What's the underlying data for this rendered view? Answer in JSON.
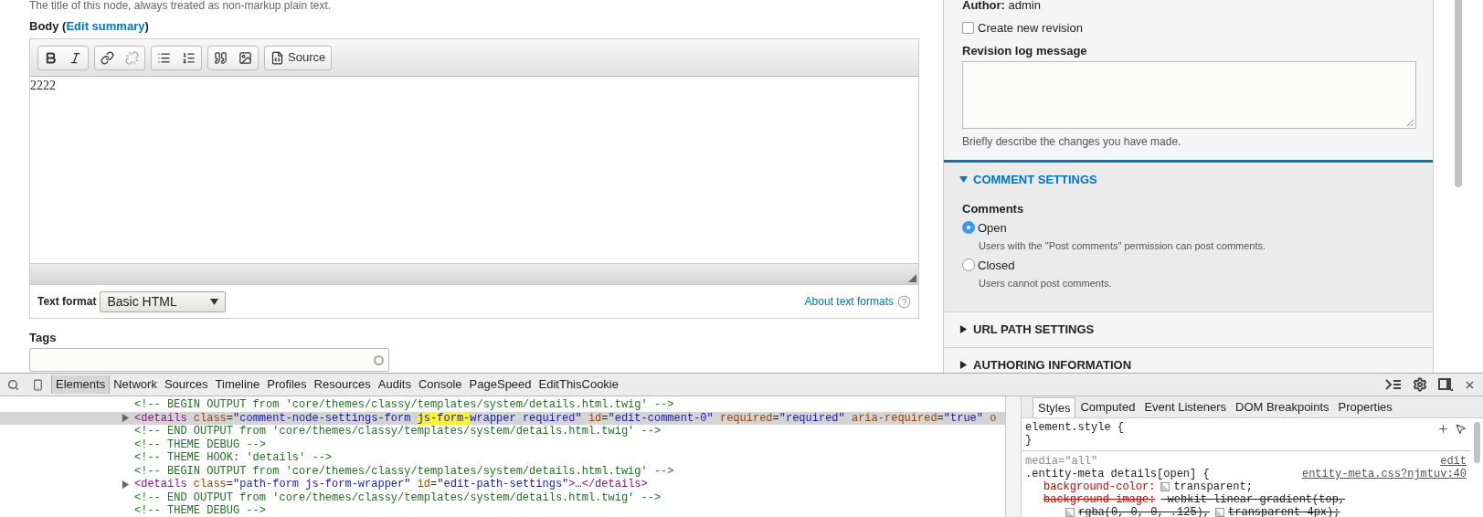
{
  "page": {
    "intro": "The title of this node, always treated as non-markup plain text.",
    "body": {
      "label_before": "Body (",
      "link": "Edit summary",
      "label_after": ")",
      "toolbar": [
        [
          {
            "kind": "bold",
            "disabled": false
          },
          {
            "kind": "italic",
            "disabled": false
          }
        ],
        [
          {
            "kind": "link",
            "disabled": false
          },
          {
            "kind": "unlink",
            "disabled": true
          }
        ],
        [
          {
            "kind": "bulleted-list",
            "disabled": false
          },
          {
            "kind": "numbered-list",
            "disabled": false
          }
        ],
        [
          {
            "kind": "blockquote",
            "disabled": false
          },
          {
            "kind": "image",
            "disabled": false
          }
        ],
        [
          {
            "kind": "source",
            "label": "Source",
            "disabled": false
          }
        ]
      ],
      "value": "2222",
      "text_format": {
        "label": "Text format",
        "value": "Basic HTML"
      },
      "about_link": "About text formats"
    },
    "tags": {
      "label": "Tags"
    }
  },
  "sidebar": {
    "author": "**Author:** admin",
    "revision_checkbox": {
      "label": "Create new revision",
      "checked": false
    },
    "revision_log": {
      "label": "Revision log message",
      "hint": "Briefly describe the changes you have made."
    },
    "sections": [
      {
        "title": "COMMENT SETTINGS",
        "expanded": true,
        "field": {
          "label": "Comments",
          "options": [
            {
              "label": "Open",
              "description": "Users with the \"Post comments\" permission can post comments.",
              "selected": true
            },
            {
              "label": "Closed",
              "description": "Users cannot post comments.",
              "selected": false
            }
          ]
        }
      },
      {
        "title": "URL PATH SETTINGS",
        "expanded": false
      },
      {
        "title": "AUTHORING INFORMATION",
        "expanded": false
      }
    ]
  },
  "devtools": {
    "tabs": [
      {
        "label": "Elements",
        "selected": true
      },
      {
        "label": "Network",
        "selected": false
      },
      {
        "label": "Sources",
        "selected": false
      },
      {
        "label": "Timeline",
        "selected": false
      },
      {
        "label": "Profiles",
        "selected": false
      },
      {
        "label": "Resources",
        "selected": false
      },
      {
        "label": "Audits",
        "selected": false
      },
      {
        "label": "Console",
        "selected": false
      },
      {
        "label": "PageSpeed",
        "selected": false
      },
      {
        "label": "EditThisCookie",
        "selected": false
      }
    ],
    "code_lines": [
      {
        "selected": false,
        "expandable": false,
        "segments": [
          {
            "kind": "comment",
            "text": "<!-- BEGIN OUTPUT from 'core/themes/classy/templates/system/details.html.twig' -->"
          }
        ]
      },
      {
        "selected": true,
        "expandable": true,
        "segments": [
          {
            "kind": "tag",
            "text": "<details"
          },
          {
            "kind": "attr",
            "text": " class"
          },
          {
            "kind": "plain",
            "text": "="
          },
          {
            "kind": "value",
            "text": "\"comment-node-settings-form "
          },
          {
            "kind": "match",
            "text": "js-form-"
          },
          {
            "kind": "value",
            "text": "wrapper required\""
          },
          {
            "kind": "attr",
            "text": " id"
          },
          {
            "kind": "plain",
            "text": "="
          },
          {
            "kind": "value",
            "text": "\"edit-comment-0\""
          },
          {
            "kind": "attr",
            "text": " required"
          },
          {
            "kind": "plain",
            "text": "="
          },
          {
            "kind": "value",
            "text": "\"required\""
          },
          {
            "kind": "attr",
            "text": " aria-required"
          },
          {
            "kind": "plain",
            "text": "="
          },
          {
            "kind": "value",
            "text": "\"true\""
          },
          {
            "kind": "attr",
            "text": " o"
          }
        ]
      },
      {
        "selected": false,
        "expandable": false,
        "segments": [
          {
            "kind": "comment",
            "text": "<!-- END OUTPUT from 'core/themes/classy/templates/system/details.html.twig' -->"
          }
        ]
      },
      {
        "selected": false,
        "expandable": false,
        "segments": [
          {
            "kind": "comment",
            "text": "<!-- THEME DEBUG -->"
          }
        ]
      },
      {
        "selected": false,
        "expandable": false,
        "segments": [
          {
            "kind": "comment",
            "text": "<!-- THEME HOOK: 'details' -->"
          }
        ]
      },
      {
        "selected": false,
        "expandable": false,
        "segments": [
          {
            "kind": "comment",
            "text": "<!-- BEGIN OUTPUT from 'core/themes/classy/templates/system/details.html.twig' -->"
          }
        ]
      },
      {
        "selected": false,
        "expandable": true,
        "segments": [
          {
            "kind": "tag",
            "text": "<details"
          },
          {
            "kind": "attr",
            "text": " class"
          },
          {
            "kind": "plain",
            "text": "="
          },
          {
            "kind": "value",
            "text": "\"path-form js-form-wrapper\""
          },
          {
            "kind": "attr",
            "text": " id"
          },
          {
            "kind": "plain",
            "text": "="
          },
          {
            "kind": "value",
            "text": "\"edit-path-settings\""
          },
          {
            "kind": "tag",
            "text": ">"
          },
          {
            "kind": "plain",
            "text": "…"
          },
          {
            "kind": "tag",
            "text": "</details>"
          }
        ]
      },
      {
        "selected": false,
        "expandable": false,
        "segments": [
          {
            "kind": "comment",
            "text": "<!-- END OUTPUT from 'core/themes/classy/templates/system/details.html.twig' -->"
          }
        ]
      },
      {
        "selected": false,
        "expandable": false,
        "segments": [
          {
            "kind": "comment",
            "text": "<!-- THEME DEBUG -->"
          }
        ]
      }
    ],
    "styles_tabs": [
      {
        "label": "Styles",
        "selected": true
      },
      {
        "label": "Computed",
        "selected": false
      },
      {
        "label": "Event Listeners",
        "selected": false
      },
      {
        "label": "DOM Breakpoints",
        "selected": false
      },
      {
        "label": "Properties",
        "selected": false
      }
    ],
    "element_style": {
      "open": "element.style {",
      "close": "}"
    },
    "rule": {
      "media": "media=\"all\"",
      "edit": "edit",
      "selector": ".entity-meta details[open] {",
      "source": "entity-meta.css?njmtuv:40",
      "properties": [
        {
          "kind": "property",
          "name": "background-color:",
          "value": "transparent;",
          "swatch": true,
          "struck": false
        },
        {
          "kind": "property",
          "name": "background-image:",
          "value": "-webkit-linear-gradient(top,",
          "swatch": false,
          "struck": true
        },
        {
          "kind": "continuation",
          "struck": true,
          "parts": [
            {
              "text": "rgba(0, 0, 0, .125),",
              "swatch": true
            },
            {
              "text": "transparent 4px);",
              "swatch": true
            }
          ]
        }
      ]
    }
  }
}
